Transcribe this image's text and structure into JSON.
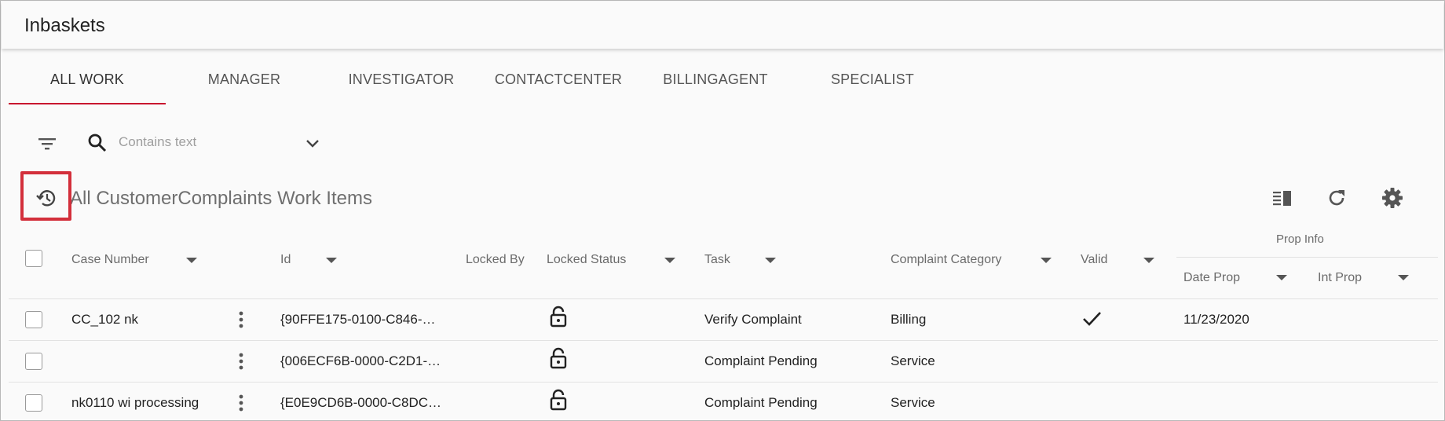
{
  "app": {
    "title": "Inbaskets"
  },
  "tabs": [
    {
      "label": "ALL WORK",
      "active": true
    },
    {
      "label": "MANAGER"
    },
    {
      "label": "INVESTIGATOR"
    },
    {
      "label": "CONTACTCENTER"
    },
    {
      "label": "BILLINGAGENT"
    },
    {
      "label": "SPECIALIST"
    }
  ],
  "toolbar": {
    "filter_icon": "filter-icon",
    "search_icon": "search-icon",
    "search_placeholder": "Contains text",
    "dropdown_icon": "chevron-down-icon"
  },
  "list": {
    "title": "All CustomerComplaints Work Items",
    "history_icon": "history-icon",
    "actions": [
      "columns-icon",
      "refresh-icon",
      "settings-icon"
    ]
  },
  "table": {
    "group_header": "Prop Info",
    "columns": {
      "case_number": "Case Number",
      "id": "Id",
      "locked_by": "Locked By",
      "locked_status": "Locked Status",
      "task": "Task",
      "complaint_category": "Complaint Category",
      "valid": "Valid",
      "date_prop": "Date Prop",
      "int_prop": "Int Prop"
    },
    "rows": [
      {
        "case_number": "CC_102 nk",
        "id": "{90FFE175-0100-C846-…",
        "locked_by": "",
        "locked_status": "unlocked",
        "task": "Verify Complaint",
        "complaint_category": "Billing",
        "valid": true,
        "date_prop": "11/23/2020",
        "int_prop": ""
      },
      {
        "case_number": "",
        "id": "{006ECF6B-0000-C2D1-…",
        "locked_by": "",
        "locked_status": "unlocked",
        "task": "Complaint Pending",
        "complaint_category": "Service",
        "valid": false,
        "date_prop": "",
        "int_prop": ""
      },
      {
        "case_number": "nk0110 wi processing",
        "id": "{E0E9CD6B-0000-C8DC…",
        "locked_by": "",
        "locked_status": "unlocked",
        "task": "Complaint Pending",
        "complaint_category": "Service",
        "valid": false,
        "date_prop": "",
        "int_prop": ""
      }
    ]
  },
  "colors": {
    "accent": "#c8102e",
    "highlight": "#d32f3b"
  }
}
